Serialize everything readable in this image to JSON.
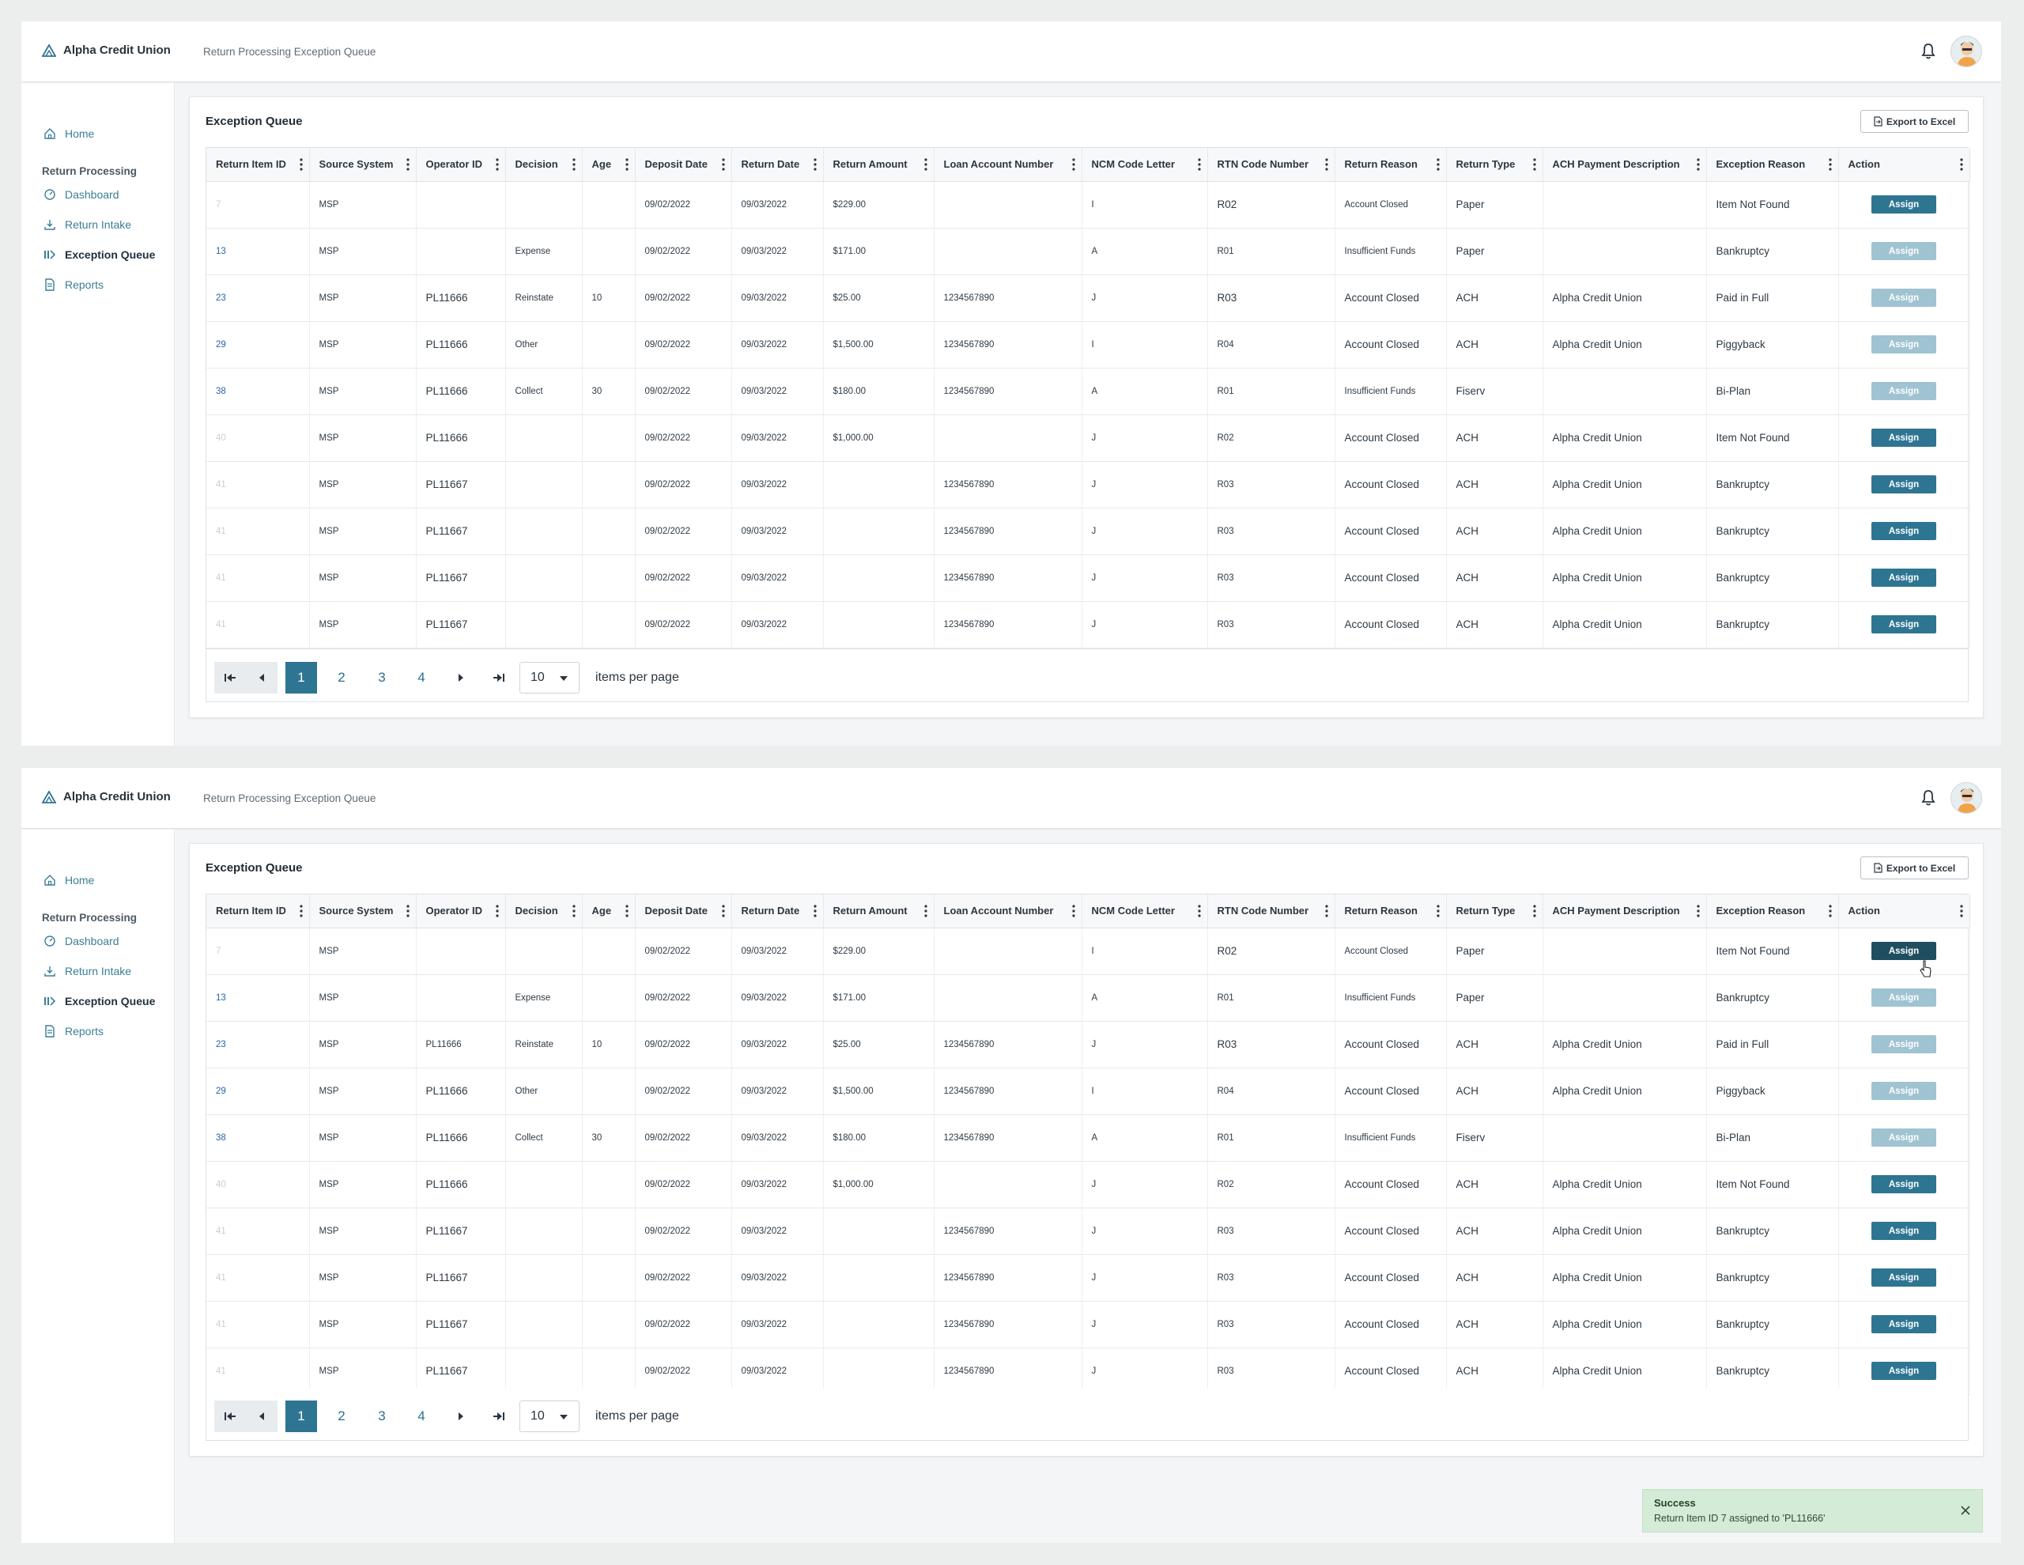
{
  "app": {
    "brand": "Alpha Credit Union",
    "breadcrumb": "Return Processing Exception Queue",
    "accent_color": "#2e7592"
  },
  "sidebar": {
    "home": "Home",
    "section": "Return Processing",
    "dashboard": "Dashboard",
    "return_intake": "Return Intake",
    "exception_queue": "Exception Queue",
    "reports": "Reports"
  },
  "panel": {
    "title": "Exception Queue",
    "export_label": "Export to Excel"
  },
  "table": {
    "columns": [
      "Return Item ID",
      "Source System",
      "Operator ID",
      "Decision",
      "Age",
      "Deposit Date",
      "Return Date",
      "Return Amount",
      "Loan Account Number",
      "NCM Code Letter",
      "RTN Code Number",
      "Return Reason",
      "Return Type",
      "ACH Payment Description",
      "Exception Reason",
      "Action"
    ],
    "action_label": "Assign",
    "rows": [
      {
        "id": "7",
        "source": "MSP",
        "operator": "",
        "decision": "",
        "age": "",
        "deposit": "09/02/2022",
        "return_date": "09/03/2022",
        "amount": "$229.00",
        "loan": "",
        "ncm": "I",
        "rtn": "R02",
        "reason": "Account Closed",
        "type": "Paper",
        "ach": "",
        "exception": "Item Not Found",
        "state": "active"
      },
      {
        "id": "13",
        "source": "MSP",
        "operator": "",
        "decision": "Expense",
        "age": "",
        "deposit": "09/02/2022",
        "return_date": "09/03/2022",
        "amount": "$171.00",
        "loan": "",
        "ncm": "A",
        "rtn": "R01",
        "reason": "Insufficient Funds",
        "type": "Paper",
        "ach": "",
        "exception": "Bankruptcy",
        "state": "disabled"
      },
      {
        "id": "23",
        "source": "MSP",
        "operator": "PL11666",
        "decision": "Reinstate",
        "age": "10",
        "deposit": "09/02/2022",
        "return_date": "09/03/2022",
        "amount": "$25.00",
        "loan": "1234567890",
        "ncm": "J",
        "rtn": "R03",
        "reason": "Account Closed",
        "type": "ACH",
        "ach": "Alpha Credit Union",
        "exception": "Paid in Full",
        "state": "disabled"
      },
      {
        "id": "29",
        "source": "MSP",
        "operator": "PL11666",
        "decision": "Other",
        "age": "",
        "deposit": "09/02/2022",
        "return_date": "09/03/2022",
        "amount": "$1,500.00",
        "loan": "1234567890",
        "ncm": "I",
        "rtn": "R04",
        "reason": "Account Closed",
        "type": "ACH",
        "ach": "Alpha Credit Union",
        "exception": "Piggyback",
        "state": "disabled"
      },
      {
        "id": "38",
        "source": "MSP",
        "operator": "PL11666",
        "decision": "Collect",
        "age": "30",
        "deposit": "09/02/2022",
        "return_date": "09/03/2022",
        "amount": "$180.00",
        "loan": "1234567890",
        "ncm": "A",
        "rtn": "R01",
        "reason": "Insufficient Funds",
        "type": "Fiserv",
        "ach": "",
        "exception": "Bi-Plan",
        "state": "disabled"
      },
      {
        "id": "40",
        "source": "MSP",
        "operator": "PL11666",
        "decision": "",
        "age": "",
        "deposit": "09/02/2022",
        "return_date": "09/03/2022",
        "amount": "$1,000.00",
        "loan": "",
        "ncm": "J",
        "rtn": "R02",
        "reason": "Account Closed",
        "type": "ACH",
        "ach": "Alpha Credit Union",
        "exception": "Item Not Found",
        "state": "active"
      },
      {
        "id": "41",
        "source": "MSP",
        "operator": "PL11667",
        "decision": "",
        "age": "",
        "deposit": "09/02/2022",
        "return_date": "09/03/2022",
        "amount": "",
        "loan": "1234567890",
        "ncm": "J",
        "rtn": "R03",
        "reason": "Account Closed",
        "type": "ACH",
        "ach": "Alpha Credit Union",
        "exception": "Bankruptcy",
        "state": "active"
      },
      {
        "id": "41",
        "source": "MSP",
        "operator": "PL11667",
        "decision": "",
        "age": "",
        "deposit": "09/02/2022",
        "return_date": "09/03/2022",
        "amount": "",
        "loan": "1234567890",
        "ncm": "J",
        "rtn": "R03",
        "reason": "Account Closed",
        "type": "ACH",
        "ach": "Alpha Credit Union",
        "exception": "Bankruptcy",
        "state": "active"
      },
      {
        "id": "41",
        "source": "MSP",
        "operator": "PL11667",
        "decision": "",
        "age": "",
        "deposit": "09/02/2022",
        "return_date": "09/03/2022",
        "amount": "",
        "loan": "1234567890",
        "ncm": "J",
        "rtn": "R03",
        "reason": "Account Closed",
        "type": "ACH",
        "ach": "Alpha Credit Union",
        "exception": "Bankruptcy",
        "state": "active"
      },
      {
        "id": "41",
        "source": "MSP",
        "operator": "PL11667",
        "decision": "",
        "age": "",
        "deposit": "09/02/2022",
        "return_date": "09/03/2022",
        "amount": "",
        "loan": "1234567890",
        "ncm": "J",
        "rtn": "R03",
        "reason": "Account Closed",
        "type": "ACH",
        "ach": "Alpha Credit Union",
        "exception": "Bankruptcy",
        "state": "active"
      }
    ]
  },
  "pagination": {
    "current": "1",
    "pages": [
      "1",
      "2",
      "3",
      "4"
    ],
    "page_size": "10",
    "per_page_label": "items per page"
  },
  "toast": {
    "title": "Success",
    "message": "Return Item ID 7 assigned to 'PL11666'",
    "color": "#d4ecd7"
  }
}
